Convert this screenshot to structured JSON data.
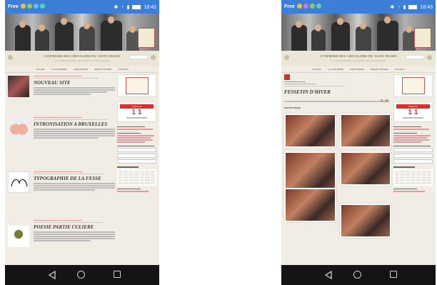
{
  "left": {
    "status": {
      "carrier": "Free",
      "time": "18:42"
    },
    "site": {
      "title": "CONFRERIE DES CHEVALIERS DU TASTE FESSES",
      "subtitle": "LA CONFRERIE DES CHEVALIERS DU TASTE FESSES",
      "nav": [
        "ACCUEIL",
        "LA CONFRERIE",
        "CHRONIQUES",
        "GRAND CONSEIL",
        "CONTACT"
      ]
    },
    "posts": [
      {
        "title": "NOUVEAU SITE"
      },
      {
        "title": "INTRONISATION A BRUXELLES"
      },
      {
        "title": "TYPOGRAPHIE DE LA FESSE"
      },
      {
        "title": "POESIE PARTIE CULIERE"
      }
    ]
  },
  "right": {
    "status": {
      "carrier": "Free",
      "time": "18:43"
    },
    "post_title": "FESSETIN D'HIVER",
    "gallery_label": "PHOTOTHEQUE"
  },
  "sidebar": {
    "subscribe_button": "S'abonner"
  },
  "colors": {
    "statusbar": "#3d7ed9",
    "accent": "#c0392b",
    "navbar": "#141414"
  }
}
